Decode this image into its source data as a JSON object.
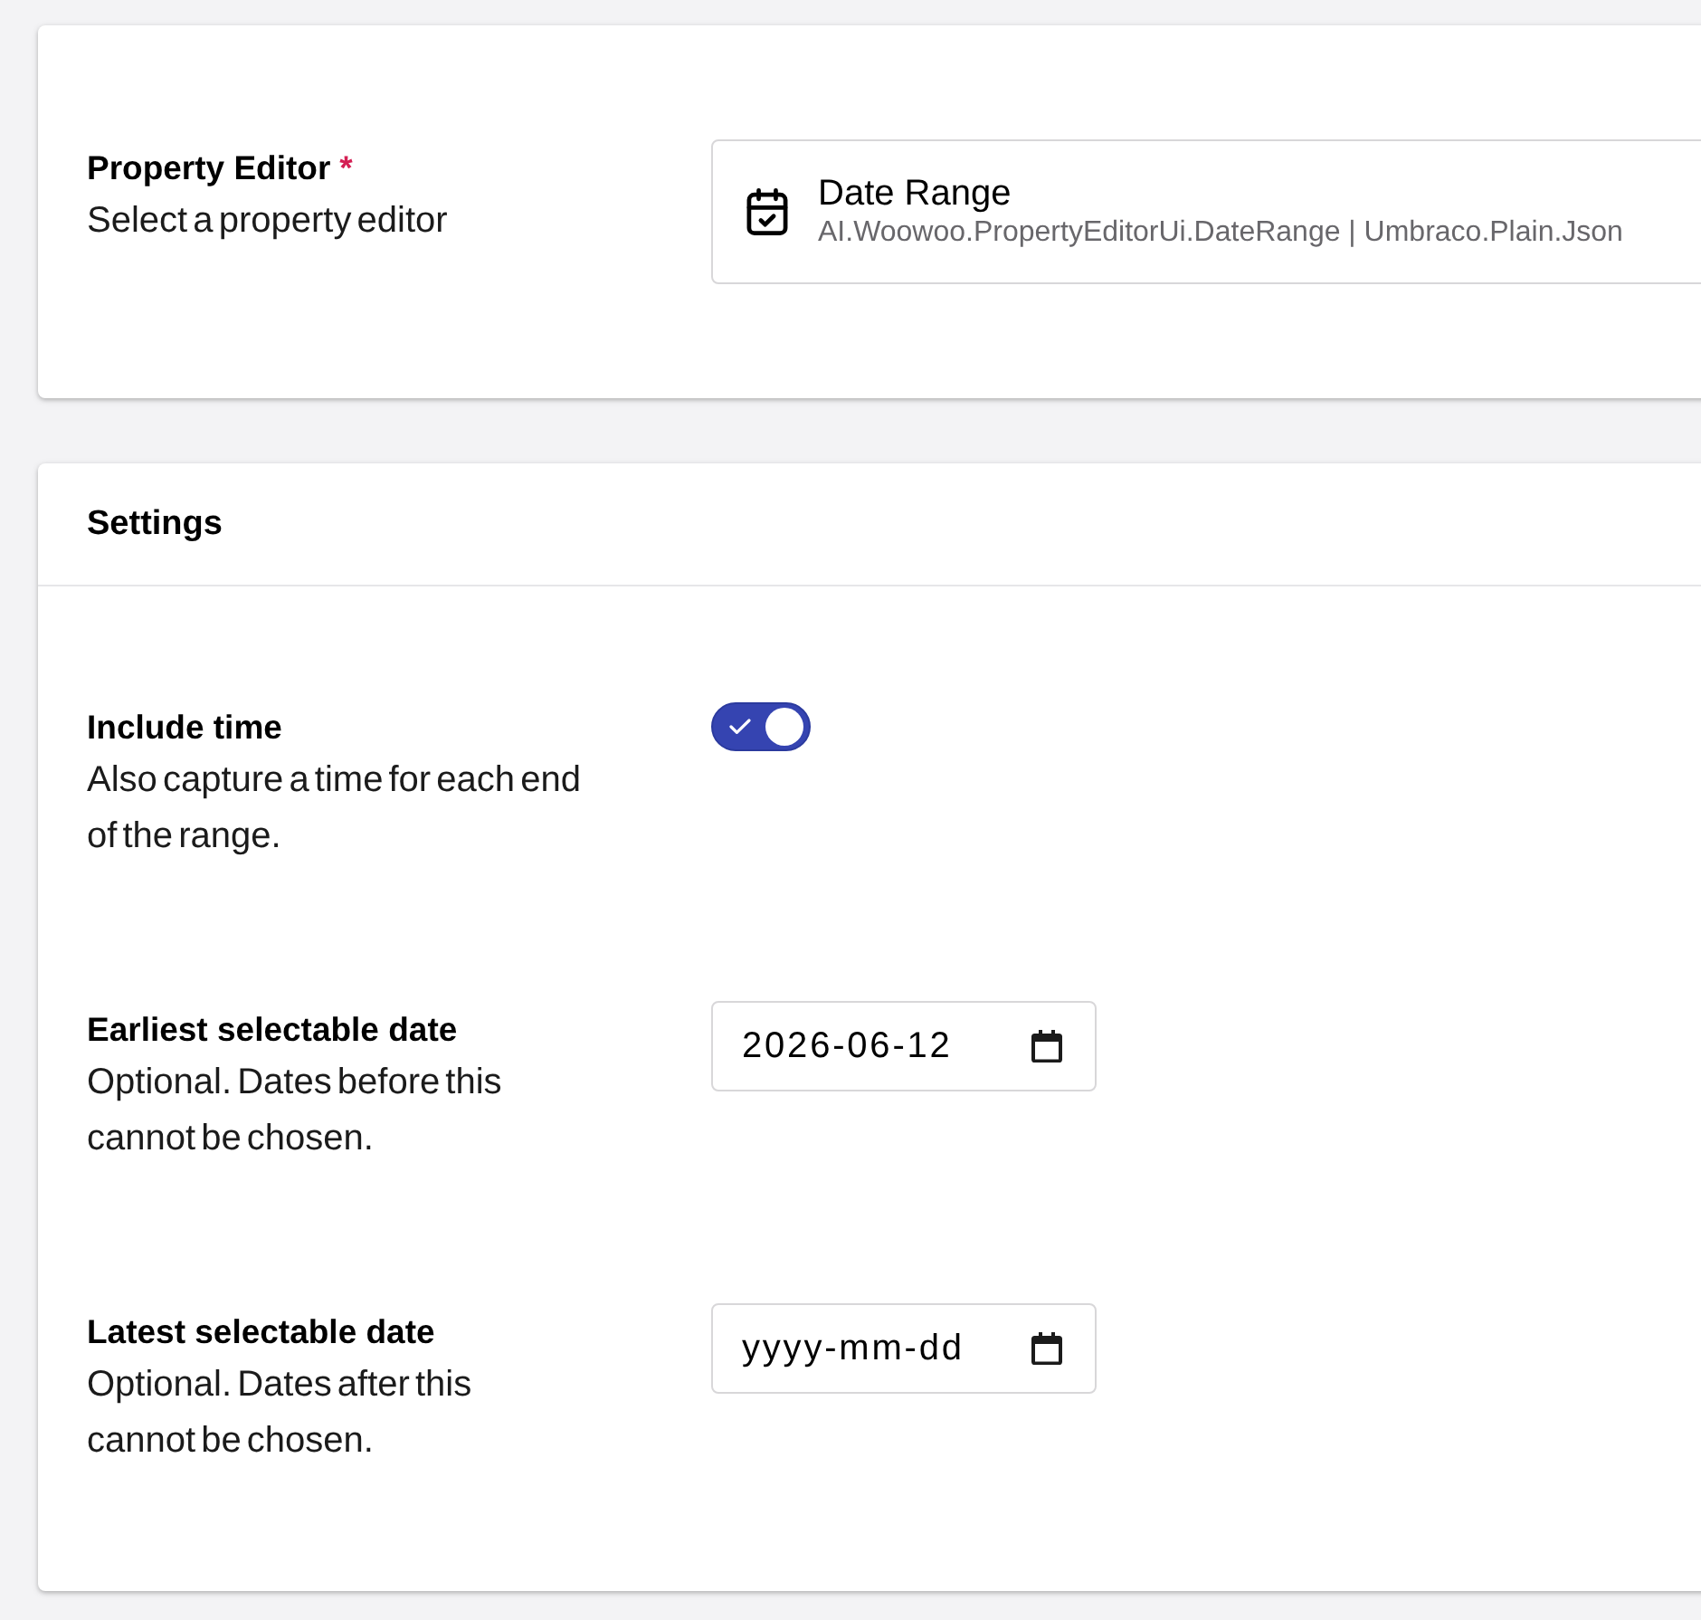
{
  "property_editor": {
    "label": "Property Editor",
    "required_mark": "*",
    "description": "Select a property editor",
    "selected": {
      "name": "Date Range",
      "alias": "AI.Woowoo.PropertyEditorUi.DateRange | Umbraco.Plain.Json"
    }
  },
  "settings": {
    "title": "Settings",
    "fields": [
      {
        "kind": "toggle",
        "label": "Include time",
        "description": "Also capture a time for each end of the range.",
        "on": true
      },
      {
        "kind": "date",
        "label": "Earliest selectable date",
        "description": "Optional. Dates before this cannot be chosen.",
        "value": "2026-06-12"
      },
      {
        "kind": "date",
        "label": "Latest selectable date",
        "description": "Optional. Dates after this cannot be chosen.",
        "placeholder": "yyyy-mm-dd"
      }
    ]
  }
}
